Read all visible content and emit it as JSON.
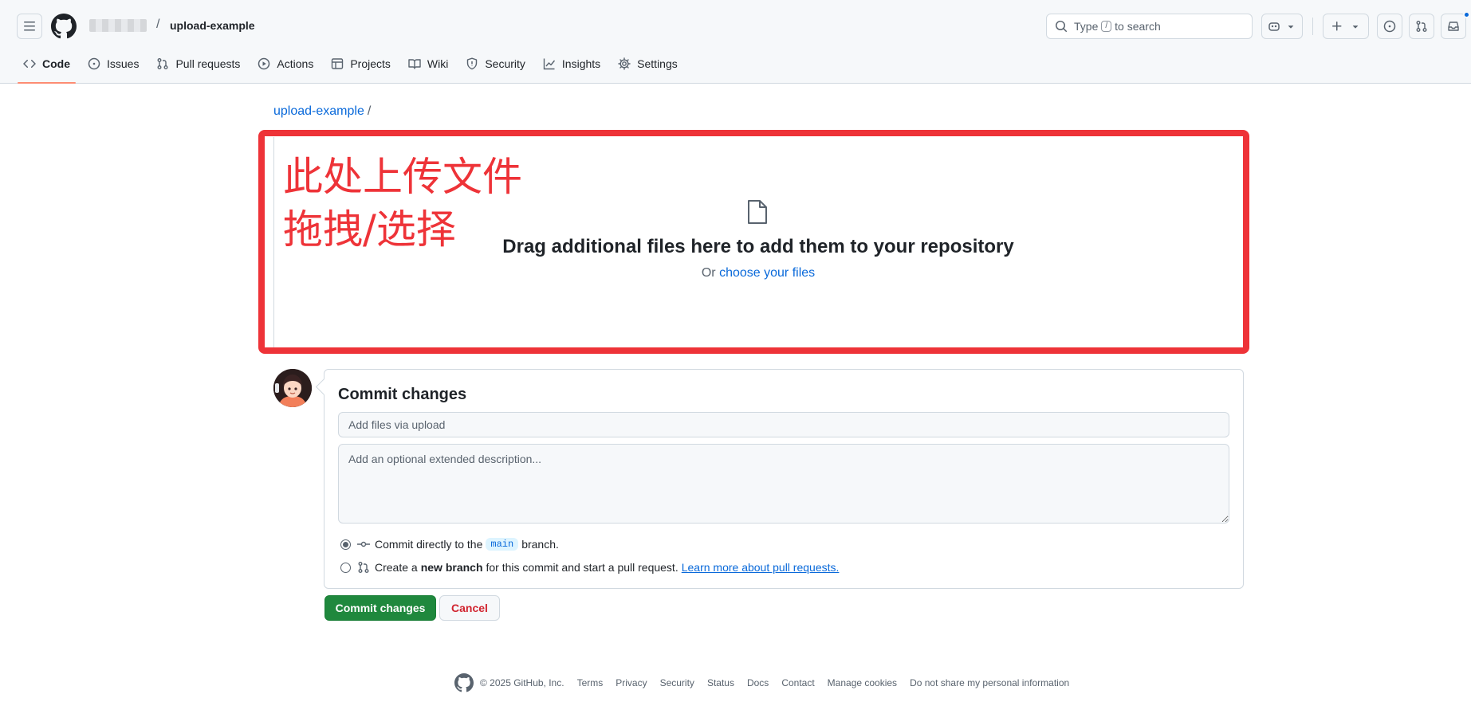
{
  "header": {
    "repo_name": "upload-example",
    "path_separator": "/",
    "search": {
      "prefix": "Type",
      "key": "/",
      "suffix": "to search"
    }
  },
  "tabs": [
    {
      "label": "Code",
      "icon": "code-icon",
      "active": true
    },
    {
      "label": "Issues",
      "icon": "issue-opened-icon"
    },
    {
      "label": "Pull requests",
      "icon": "git-pull-request-icon"
    },
    {
      "label": "Actions",
      "icon": "play-icon"
    },
    {
      "label": "Projects",
      "icon": "table-icon"
    },
    {
      "label": "Wiki",
      "icon": "book-icon"
    },
    {
      "label": "Security",
      "icon": "shield-icon"
    },
    {
      "label": "Insights",
      "icon": "graph-icon"
    },
    {
      "label": "Settings",
      "icon": "gear-icon"
    }
  ],
  "breadcrumb": {
    "repo": "upload-example",
    "separator": "/"
  },
  "annotation": {
    "line1": "此处上传文件",
    "line2": "拖拽/选择",
    "color": "#ee3338"
  },
  "upload": {
    "title": "Drag additional files here to add them to your repository",
    "or": "Or",
    "choose_link": "choose your files"
  },
  "commit": {
    "title": "Commit changes",
    "summary_placeholder": "Add files via upload",
    "description_placeholder": "Add an optional extended description...",
    "option_direct": {
      "prefix": "Commit directly to the",
      "branch": "main",
      "suffix": "branch."
    },
    "option_new_branch": {
      "prefix": "Create a",
      "bold": "new branch",
      "suffix": "for this commit and start a pull request.",
      "link": "Learn more about pull requests."
    },
    "submit_label": "Commit changes",
    "cancel_label": "Cancel"
  },
  "colors": {
    "accent": "#0969da",
    "primary_button": "#1f883d",
    "danger": "#d1242f",
    "tab_underline": "#fd8c73"
  },
  "footer": {
    "copyright": "© 2025 GitHub, Inc.",
    "links": [
      "Terms",
      "Privacy",
      "Security",
      "Status",
      "Docs",
      "Contact",
      "Manage cookies",
      "Do not share my personal information"
    ]
  }
}
